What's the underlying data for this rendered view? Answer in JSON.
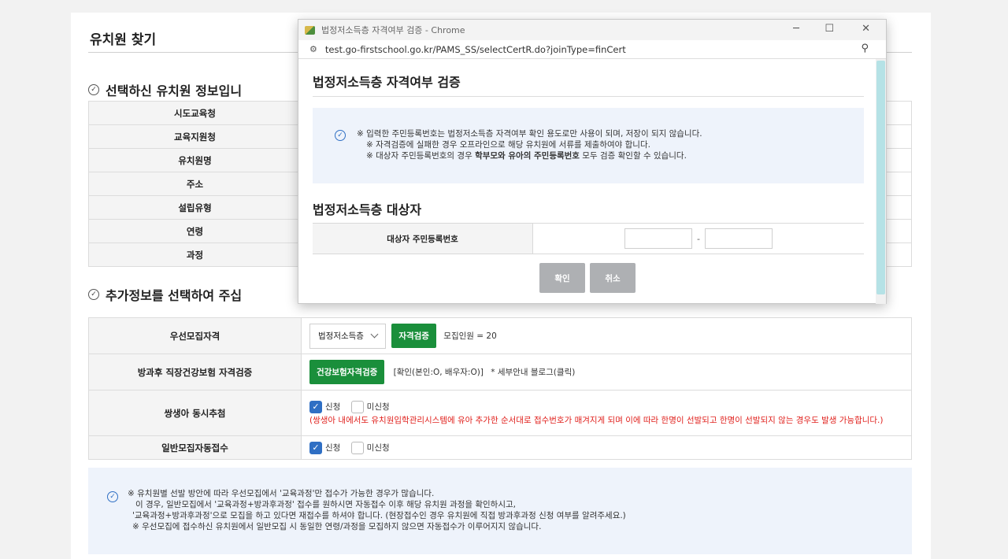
{
  "page": {
    "title": "유치원 찾기",
    "section1_title": "선택하신 유치원 정보입니",
    "section2_title": "추가정보를 선택하여 주십",
    "info_rows": [
      "시도교육청",
      "교육지원청",
      "유치원명",
      "주소",
      "설립유형",
      "연령",
      "과정"
    ],
    "extra": {
      "priority_label": "우선모집자격",
      "priority_select_value": "법정저소득층",
      "verify_button": "자격검증",
      "recruit_count": "모집인원 = 20",
      "insurance_label": "방과후 직장건강보험 자격검증",
      "insurance_button": "건강보험자격검증",
      "insurance_result": "[확인(본인:O, 배우자:O)]",
      "insurance_link": "* 세부안내 블로그(클릭)",
      "twins_label": "쌍생아 동시추첨",
      "apply_label": "신청",
      "not_apply_label": "미신청",
      "twins_note": "(쌍생아 내에서도 유치원입학관리시스템에 유아 추가한 순서대로 접수번호가 매겨지게 되며 이에 따라 한명이 선발되고 한명이 선발되지 않는 경우도 발생 가능합니다.)",
      "auto_label": "일반모집자동접수"
    },
    "bottom_notice": [
      "※ 유치원별 선발 방안에 따라 우선모집에서 '교육과정'만 접수가 가능한 경우가 많습니다.",
      "이 경우, 일반모집에서 '교육과정+방과후과정' 접수를 원하시면 자동접수 이후 해당 유치원 과정을 확인하시고,",
      "'교육과정+방과후과정'으로 모집을 하고 있다면 재접수를 하셔야 합니다. (현장접수인 경우 유치원에 직접 방과후과정 신청 여부를 알려주세요.)",
      "※ 우선모집에 접수하신 유치원에서 일반모집 시 동일한 연령/과정을 모집하지 않으면 자동접수가 이루어지지 않습니다."
    ]
  },
  "popup": {
    "window_title": "법정저소득층 자격여부 검증 - Chrome",
    "url": "test.go-firstschool.go.kr/PAMS_SS/selectCertR.do?joinType=finCert",
    "heading": "법정저소득층 자격여부 검증",
    "notice_line1": "※ 입력한 주민등록번호는 법정저소득층 자격여부 확인 용도로만 사용이 되며, 저장이 되지 않습니다.",
    "notice_line2": "※ 자격검증에 실패한 경우 오프라인으로 해당 유치원에 서류를 제출하여야 합니다.",
    "notice_line3_a": "※ 대상자 주민등록번호의 경우 ",
    "notice_line3_b": "학부모와 유아의 주민등록번호",
    "notice_line3_c": " 모두 검증 확인할 수 있습니다.",
    "sub_heading": "법정저소득층 대상자",
    "ssn_label": "대상자 주민등록번호",
    "ssn_front": "",
    "ssn_back": "",
    "ssn_dash": "-",
    "confirm_button": "확인",
    "cancel_button": "취소"
  },
  "colors": {
    "green": "#1a8f3b",
    "blue_check": "#2f6fc4",
    "red_note": "#e0201c",
    "notice_bg": "#eef3fb",
    "scroll_thumb": "#b5e2e6"
  }
}
